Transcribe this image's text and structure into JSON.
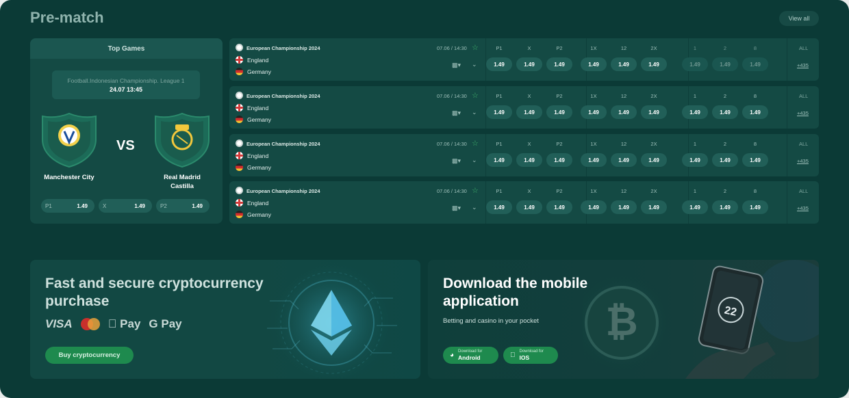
{
  "header": {
    "title": "Pre-match",
    "view_all": "View all"
  },
  "top_games": {
    "title": "Top Games",
    "league": "Football.Indonesian Championship. League 1",
    "date": "24.07 13:45",
    "vs": "VS",
    "home": "Manchester City",
    "away_line1": "Real Madrid",
    "away_line2": "Castilla",
    "odds": [
      {
        "label": "P1",
        "value": "1.49"
      },
      {
        "label": "X",
        "value": "1.49"
      },
      {
        "label": "P2",
        "value": "1.49"
      }
    ]
  },
  "matches": [
    {
      "league": "European Championship 2024",
      "time": "07.06 / 14:30",
      "team1": "England",
      "team2": "Germany",
      "more": "+435"
    },
    {
      "league": "European Championship 2024",
      "time": "07.06 / 14:30",
      "team1": "England",
      "team2": "Germany",
      "more": "+435"
    },
    {
      "league": "European Championship 2024",
      "time": "07.06 / 14:30",
      "team1": "England",
      "team2": "Germany",
      "more": "+435"
    },
    {
      "league": "European Championship 2024",
      "time": "07.06 / 14:30",
      "team1": "England",
      "team2": "Germany",
      "more": "+435"
    }
  ],
  "odds_columns": [
    {
      "label": "P1",
      "value": "1.49"
    },
    {
      "label": "X",
      "value": "1.49"
    },
    {
      "label": "P2",
      "value": "1.49"
    },
    {
      "label": "1X",
      "value": "1.49"
    },
    {
      "label": "12",
      "value": "1.49"
    },
    {
      "label": "2X",
      "value": "1.49"
    },
    {
      "label": "1",
      "value": "1.49"
    },
    {
      "label": "2",
      "value": "1.49"
    },
    {
      "label": "8",
      "value": "1.49"
    }
  ],
  "all_label": "ALL",
  "crypto_banner": {
    "title": "Fast and secure cryptocurrency purchase",
    "pay_visa": "VISA",
    "pay_apple": " Pay",
    "pay_google": "G Pay",
    "button": "Buy cryptocurrency"
  },
  "app_banner": {
    "title": "Download the mobile application",
    "subtitle": "Betting and casino in your pocket",
    "android_small": "Download for",
    "android_big": "Android",
    "ios_small": "Download for",
    "ios_big": "IOS",
    "phone_badge": "22"
  },
  "colors": {
    "background": "#0b3a36",
    "card": "#144a44",
    "accent_green": "#1e8a4e"
  }
}
